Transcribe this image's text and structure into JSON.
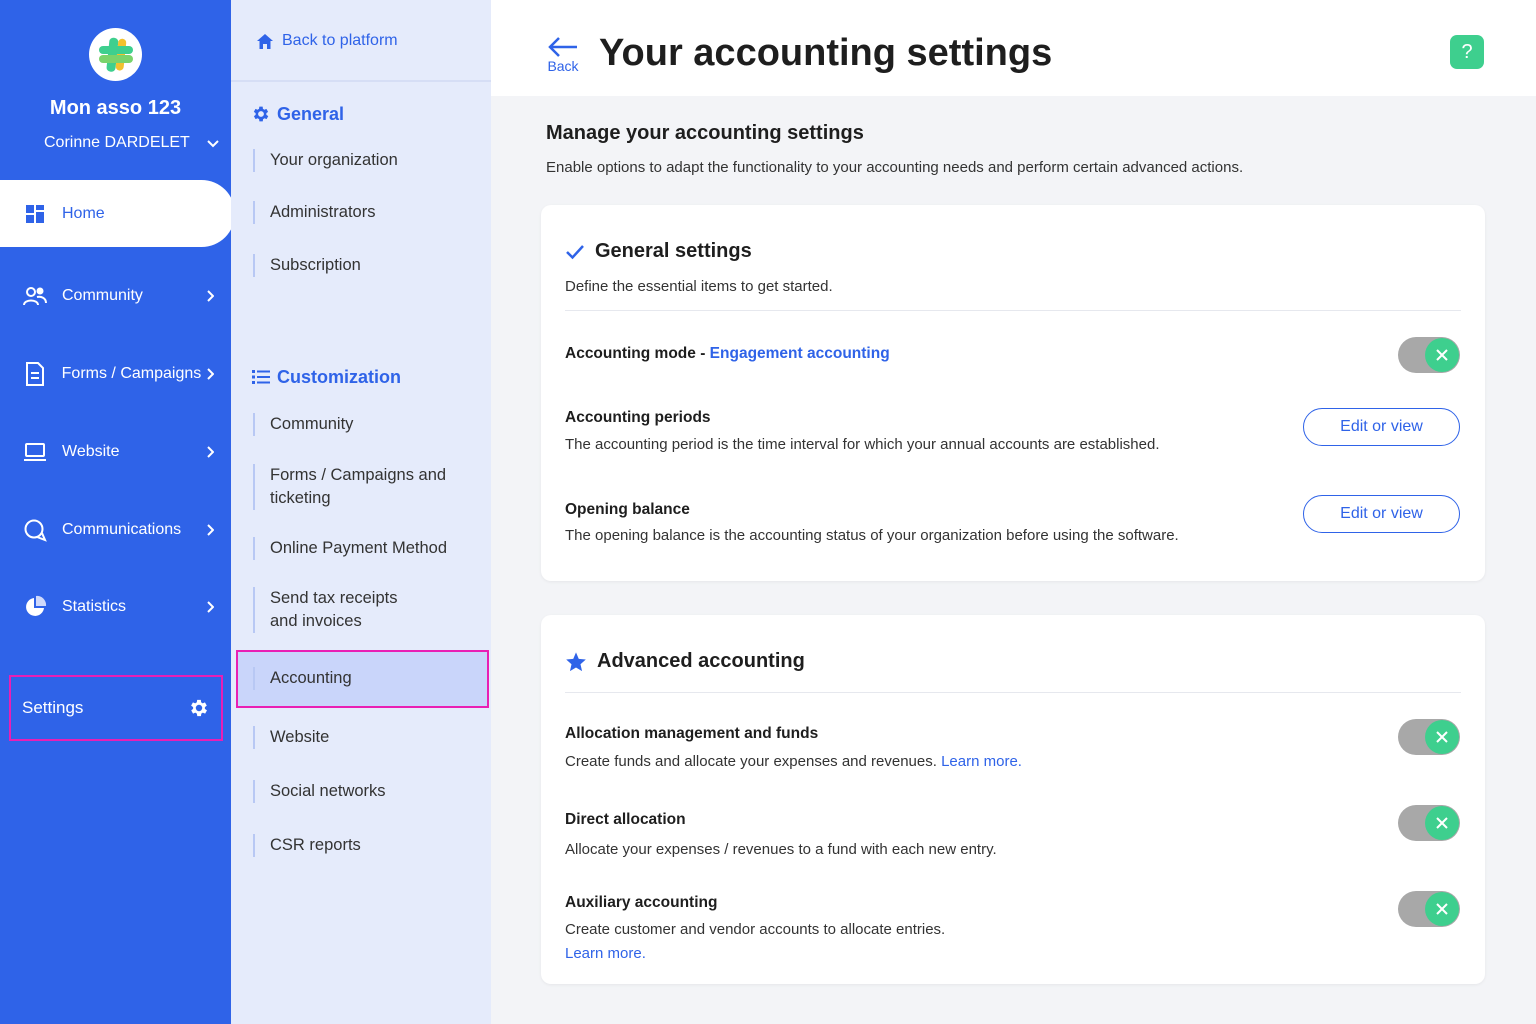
{
  "nav": {
    "org_name": "Mon asso 123",
    "user_name": "Corinne DARDELET",
    "items": [
      {
        "label": "Home",
        "icon": "dashboard-icon"
      },
      {
        "label": "Community",
        "icon": "users-icon"
      },
      {
        "label": "Forms / Campaigns",
        "icon": "document-icon"
      },
      {
        "label": "Website",
        "icon": "laptop-icon"
      },
      {
        "label": "Communications",
        "icon": "chat-icon"
      },
      {
        "label": "Statistics",
        "icon": "pie-chart-icon"
      }
    ],
    "settings_label": "Settings"
  },
  "subnav": {
    "back_label": "Back to platform",
    "general_heading": "General",
    "general_items": [
      "Your organization",
      "Administrators",
      "Subscription"
    ],
    "customization_heading": "Customization",
    "customization_items": [
      "Community",
      "Forms / Campaigns and ticketing",
      "Online Payment Method",
      "Send tax receipts and invoices",
      "Accounting",
      "Website",
      "Social networks",
      "CSR reports"
    ],
    "selected": "Accounting"
  },
  "header": {
    "back_label": "Back",
    "title": "Your accounting settings",
    "help_label": "?"
  },
  "main": {
    "title": "Manage your accounting settings",
    "description": "Enable options to adapt the functionality to your accounting needs and perform certain advanced actions."
  },
  "general_card": {
    "title": "General settings",
    "subtitle": "Define the essential items to get started.",
    "accounting_mode_label": "Accounting mode",
    "accounting_mode_separator": " - ",
    "accounting_mode_value": "Engagement accounting",
    "periods_title": "Accounting periods",
    "periods_desc": "The accounting period is the time interval for which your annual accounts are established.",
    "opening_title": "Opening balance",
    "opening_desc": "The opening balance is the accounting status of your organization before using the software.",
    "edit_label": "Edit or view"
  },
  "advanced_card": {
    "title": "Advanced accounting",
    "allocation_title": "Allocation management and funds",
    "allocation_desc": "Create funds and allocate your expenses and revenues.",
    "learn_more": "Learn more.",
    "direct_title": "Direct allocation",
    "direct_desc": "Allocate your expenses / revenues to a fund with each new entry.",
    "auxiliary_title": "Auxiliary accounting",
    "auxiliary_desc": "Create customer and vendor accounts to allocate entries."
  },
  "colors": {
    "primary": "#2f63e8",
    "accent_green": "#3ecf8e",
    "highlight": "#e91fb4"
  }
}
